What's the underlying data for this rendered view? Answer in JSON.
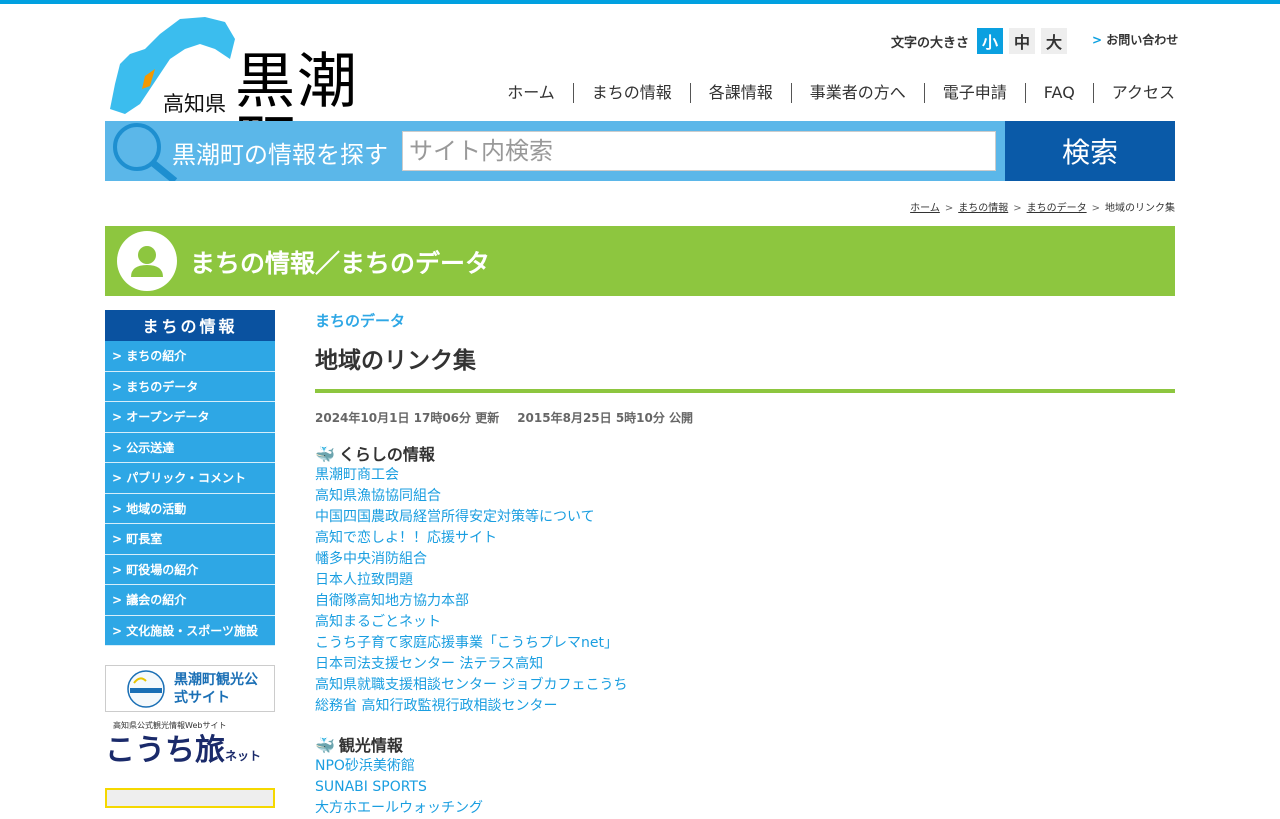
{
  "header": {
    "pref": "高知県",
    "town": "黒潮町",
    "font_size_label": "文字の大きさ",
    "font_sizes": [
      "小",
      "中",
      "大"
    ],
    "contact": "お問い合わせ"
  },
  "nav": [
    "ホーム",
    "まちの情報",
    "各課情報",
    "事業者の方へ",
    "電子申請",
    "FAQ",
    "アクセス"
  ],
  "search": {
    "label": "黒潮町の情報を探す",
    "placeholder": "サイト内検索",
    "button": "検索"
  },
  "breadcrumb": [
    "ホーム",
    "まちの情報",
    "まちのデータ",
    "地域のリンク集"
  ],
  "banner_title": "まちの情報／まちのデータ",
  "sidebar": {
    "heading": "まちの情報",
    "items": [
      "まちの紹介",
      "まちのデータ",
      "オープンデータ",
      "公示送達",
      "パブリック・コメント",
      "地域の活動",
      "町長室",
      "町役場の紹介",
      "議会の紹介",
      "文化施設・スポーツ施設"
    ],
    "banner1": "黒潮町観光公式サイト",
    "banner1_logo": "KUROSHIO",
    "banner2_sub": "高知県公式観光情報Webサイト",
    "banner2_main": "こうち旅",
    "banner2_suffix": "ネット"
  },
  "main": {
    "category": "まちのデータ",
    "title": "地域のリンク集",
    "updated": "2024年10月1日 17時06分 更新",
    "published": "2015年8月25日 5時10分 公開",
    "sections": [
      {
        "heading": "くらしの情報",
        "links": [
          "黒潮町商工会",
          "高知県漁協協同組合",
          "中国四国農政局経営所得安定対策等について",
          "高知で恋しよ！！応援サイト",
          "幡多中央消防組合",
          "日本人拉致問題",
          "自衛隊高知地方協力本部",
          "高知まるごとネット",
          "こうち子育て家庭応援事業「こうちプレマnet」",
          "日本司法支援センター 法テラス高知",
          "高知県就職支援相談センター ジョブカフェこうち",
          "総務省 高知行政監視行政相談センター"
        ]
      },
      {
        "heading": "観光情報",
        "links": [
          "NPO砂浜美術館",
          "SUNABI SPORTS",
          "大方ホエールウォッチング"
        ]
      }
    ]
  },
  "colors": {
    "accent": "#00a0e0",
    "green": "#8dc63f",
    "navy": "#0a52a0",
    "link": "#1a9ee0"
  }
}
